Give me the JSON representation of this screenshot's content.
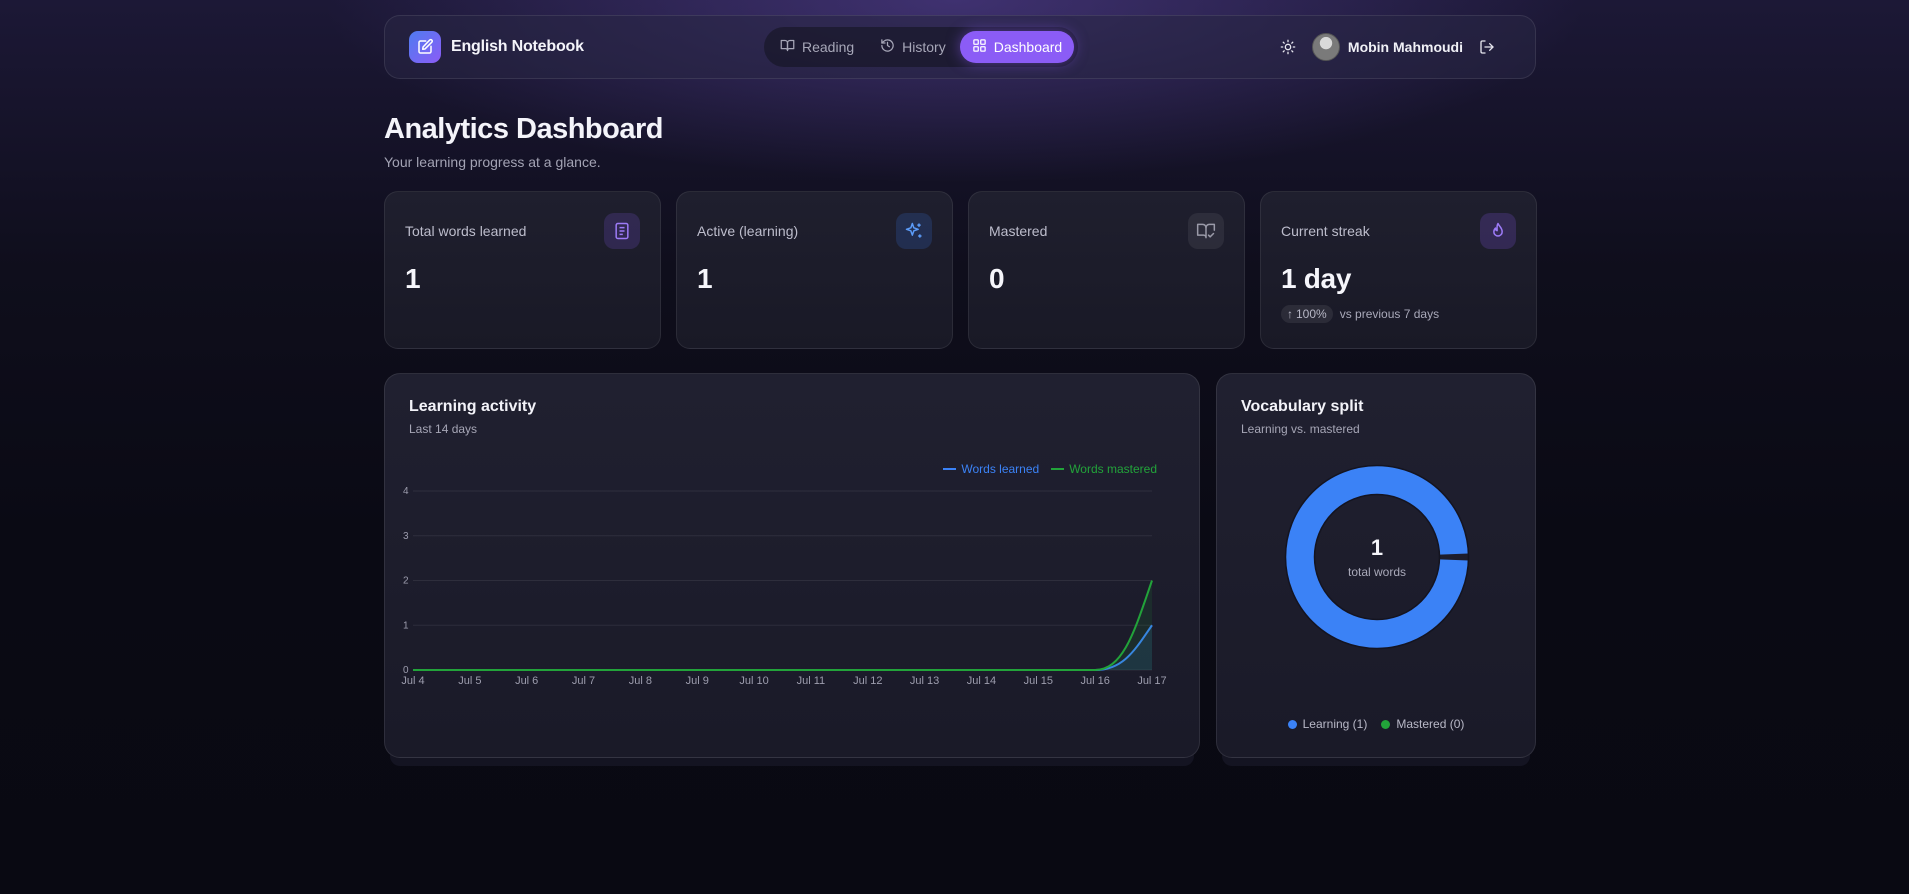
{
  "app": {
    "name": "English Notebook"
  },
  "nav": {
    "tabs": [
      {
        "label": "Reading",
        "icon": "book-open-icon",
        "active": false
      },
      {
        "label": "History",
        "icon": "history-icon",
        "active": false
      },
      {
        "label": "Dashboard",
        "icon": "grid-icon",
        "active": true
      }
    ],
    "user_name": "Mobin Mahmoudi"
  },
  "header": {
    "title": "Analytics Dashboard",
    "subtitle": "Your learning progress at a glance."
  },
  "stats": [
    {
      "label": "Total words learned",
      "value": "1",
      "icon": "book-icon"
    },
    {
      "label": "Active (learning)",
      "value": "1",
      "icon": "sparkles-icon"
    },
    {
      "label": "Mastered",
      "value": "0",
      "icon": "book-check-icon"
    },
    {
      "label": "Current streak",
      "value": "1 day",
      "icon": "flame-icon",
      "change": "100%",
      "change_note": "vs previous 7 days"
    }
  ],
  "activity": {
    "title": "Learning activity",
    "subtitle": "Last 14 days"
  },
  "split": {
    "title": "Vocabulary split",
    "subtitle": "Learning vs. mastered",
    "center_value": "1",
    "center_label": "total words",
    "legend_learning": "Learning (1)",
    "legend_mastered": "Mastered (0)"
  },
  "colors": {
    "accent": "#8b5cf6",
    "learned": "#3b82f6",
    "mastered": "#22a33a"
  },
  "chart_data": [
    {
      "type": "area",
      "categories": [
        "Jul 4",
        "Jul 5",
        "Jul 6",
        "Jul 7",
        "Jul 8",
        "Jul 9",
        "Jul 10",
        "Jul 11",
        "Jul 12",
        "Jul 13",
        "Jul 14",
        "Jul 15",
        "Jul 16",
        "Jul 17"
      ],
      "series": [
        {
          "name": "Words learned",
          "values": [
            0,
            0,
            0,
            0,
            0,
            0,
            0,
            0,
            0,
            0,
            0,
            0,
            0,
            1
          ]
        },
        {
          "name": "Words mastered",
          "values": [
            0,
            0,
            0,
            0,
            0,
            0,
            0,
            0,
            0,
            0,
            0,
            0,
            0,
            2
          ]
        }
      ],
      "yticks": [
        "0",
        "1",
        "2",
        "3",
        "4"
      ],
      "ylim": [
        0,
        4
      ],
      "grid": true,
      "legend": "top-right"
    },
    {
      "type": "pie",
      "categories": [
        "Learning",
        "Mastered"
      ],
      "values": [
        1,
        0
      ]
    }
  ]
}
